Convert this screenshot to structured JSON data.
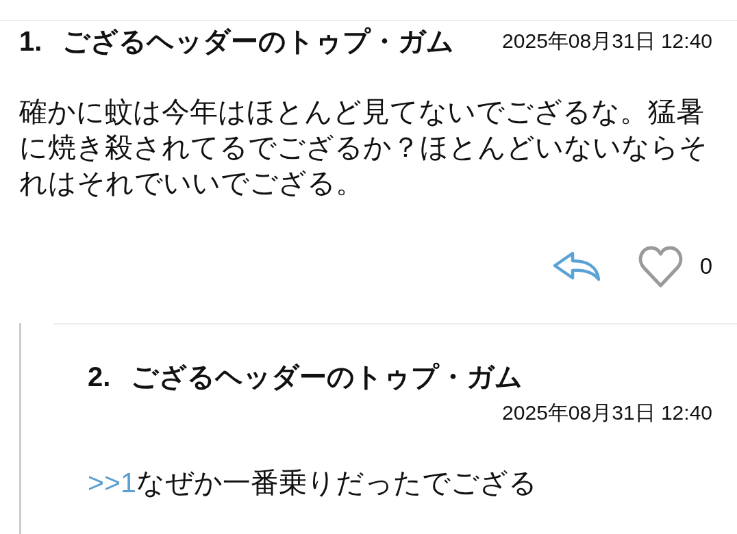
{
  "thread": [
    {
      "number": "1.",
      "author": "ござるヘッダーのトゥプ・ガム",
      "date": "2025年08月31日 12:40",
      "body": "確かに蚊は今年はほとんど見てないでござるな。猛暑に焼き殺されてるでござるか？ほとんどいないならそれはそれでいいでござる。",
      "liked": false,
      "likes": "0",
      "children": [
        {
          "number": "2.",
          "author": "ござるヘッダーのトゥプ・ガム",
          "date": "2025年08月31日 12:40",
          "anchor": ">>1",
          "body": "なぜか一番乗りだったでござる"
        }
      ]
    }
  ]
}
